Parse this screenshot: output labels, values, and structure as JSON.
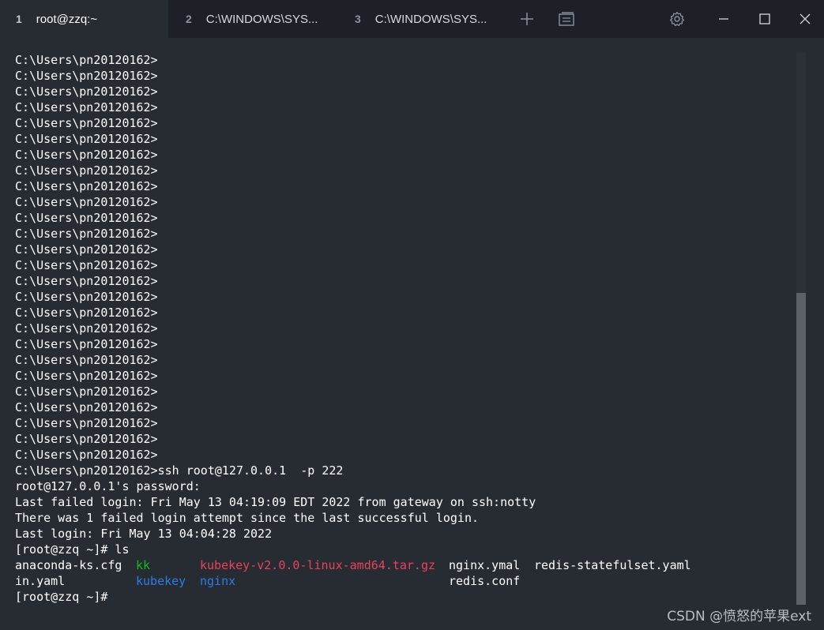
{
  "tabs": [
    {
      "number": "1",
      "title": "root@zzq:~"
    },
    {
      "number": "2",
      "title": "C:\\WINDOWS\\SYS..."
    },
    {
      "number": "3",
      "title": "C:\\WINDOWS\\SYS..."
    }
  ],
  "icons": {
    "new_tab": "plus-icon",
    "tab_switcher": "window-list-icon",
    "settings": "gear-icon",
    "minimize": "minimize-icon",
    "maximize": "maximize-icon",
    "close": "close-icon"
  },
  "terminal": {
    "prompt_lines": [
      "C:\\Users\\pn20120162>",
      "C:\\Users\\pn20120162>",
      "C:\\Users\\pn20120162>",
      "C:\\Users\\pn20120162>",
      "C:\\Users\\pn20120162>",
      "C:\\Users\\pn20120162>",
      "C:\\Users\\pn20120162>",
      "C:\\Users\\pn20120162>",
      "C:\\Users\\pn20120162>",
      "C:\\Users\\pn20120162>",
      "C:\\Users\\pn20120162>",
      "C:\\Users\\pn20120162>",
      "C:\\Users\\pn20120162>",
      "C:\\Users\\pn20120162>",
      "C:\\Users\\pn20120162>",
      "C:\\Users\\pn20120162>",
      "C:\\Users\\pn20120162>",
      "C:\\Users\\pn20120162>",
      "C:\\Users\\pn20120162>",
      "C:\\Users\\pn20120162>",
      "C:\\Users\\pn20120162>",
      "C:\\Users\\pn20120162>",
      "C:\\Users\\pn20120162>",
      "C:\\Users\\pn20120162>",
      "C:\\Users\\pn20120162>",
      "C:\\Users\\pn20120162>"
    ],
    "ssh_command": "C:\\Users\\pn20120162>ssh root@127.0.0.1  -p 222",
    "password_prompt": "root@127.0.0.1's password:",
    "failed_login": "Last failed login: Fri May 13 04:19:09 EDT 2022 from gateway on ssh:notty",
    "failed_attempts": "There was 1 failed login attempt since the last successful login.",
    "last_login": "Last login: Fri May 13 04:04:28 2022",
    "ls_command": "[root@zzq ~]# ls",
    "ls_output": {
      "row1": [
        "anaconda-ks.cfg",
        "kk",
        "kubekey-v2.0.0-linux-amd64.tar.gz",
        "nginx.ymal",
        "redis-statefulset.yaml"
      ],
      "row2": [
        "in.yaml",
        "kubekey",
        "nginx",
        "redis.conf"
      ]
    },
    "final_prompt": "[root@zzq ~]#"
  },
  "colors": {
    "background": "#272c33",
    "tabbar": "#1d2127",
    "text": "#ffffff",
    "executable": "#16b820",
    "archive": "#e8425c",
    "directory": "#2f7be8"
  },
  "watermark": "CSDN @愤怒的苹果ext"
}
